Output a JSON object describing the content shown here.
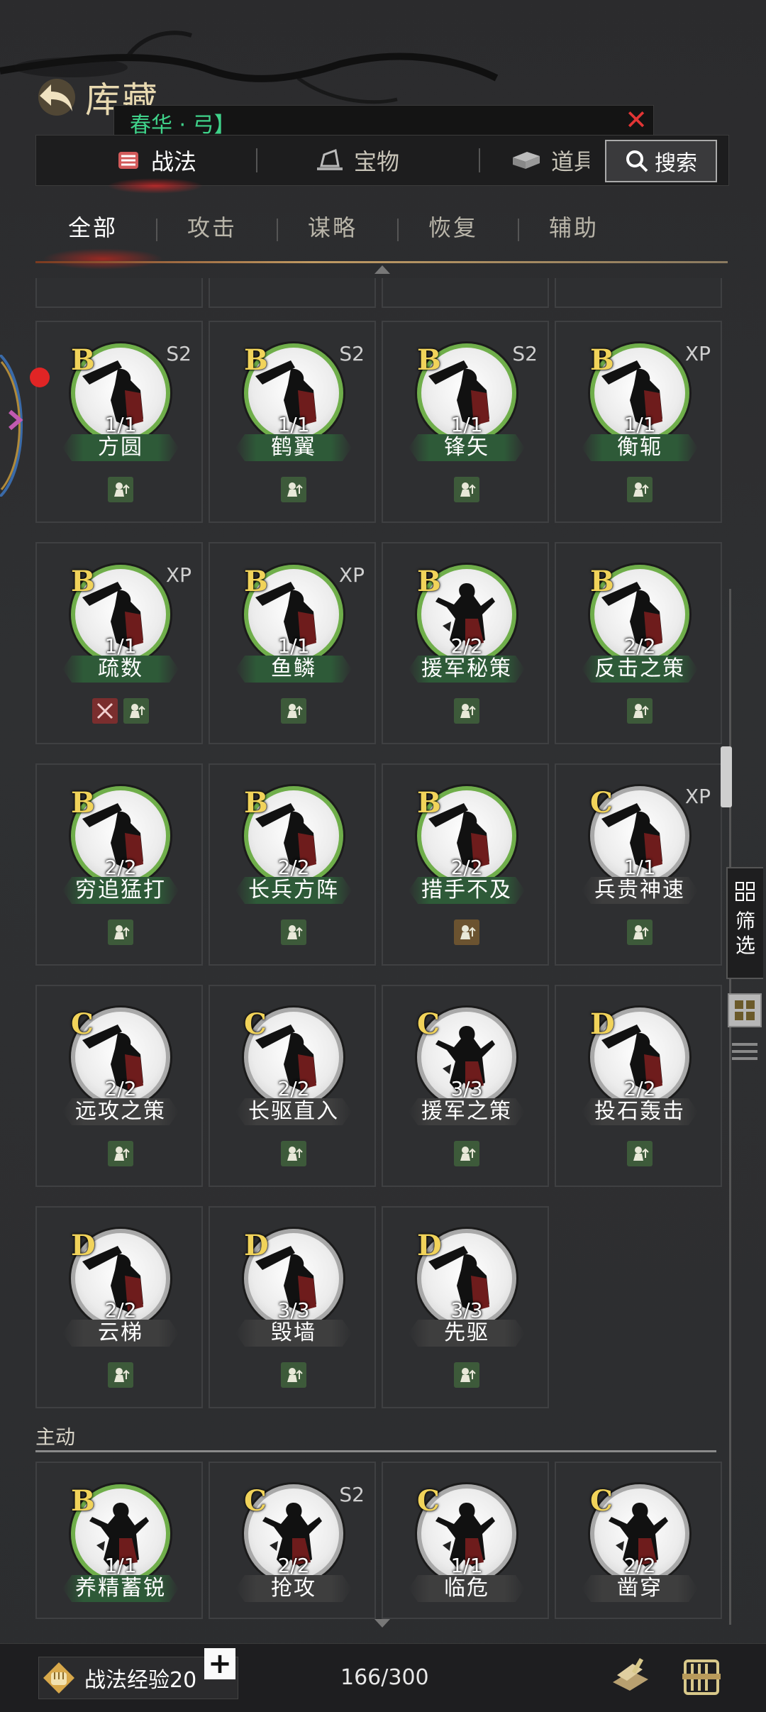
{
  "header": {
    "title": "库藏",
    "search_term": "春华 · 弓】"
  },
  "tabs": [
    {
      "label": "战法",
      "icon": "scroll-icon",
      "active": true
    },
    {
      "label": "宝物",
      "icon": "treasure-icon",
      "active": false
    },
    {
      "label": "道具",
      "icon": "item-box-icon",
      "active": false
    }
  ],
  "search_label": "搜索",
  "subtabs": [
    "全部",
    "攻击",
    "谋略",
    "恢复",
    "辅助"
  ],
  "tactics": [
    {
      "grade": "B",
      "season": "S2",
      "count": "1/1",
      "name": "方圆",
      "types": [
        "green"
      ]
    },
    {
      "grade": "B",
      "season": "S2",
      "count": "1/1",
      "name": "鹤翼",
      "types": [
        "green"
      ]
    },
    {
      "grade": "B",
      "season": "S2",
      "count": "1/1",
      "name": "锋矢",
      "types": [
        "green"
      ]
    },
    {
      "grade": "B",
      "season": "XP",
      "count": "1/1",
      "name": "衡轭",
      "types": [
        "green"
      ]
    },
    {
      "grade": "B",
      "season": "XP",
      "count": "1/1",
      "name": "疏数",
      "types": [
        "red",
        "green"
      ]
    },
    {
      "grade": "B",
      "season": "XP",
      "count": "1/1",
      "name": "鱼鳞",
      "types": [
        "green"
      ]
    },
    {
      "grade": "B",
      "season": "",
      "count": "2/2",
      "name": "援军秘策",
      "types": [
        "green"
      ]
    },
    {
      "grade": "B",
      "season": "",
      "count": "2/2",
      "name": "反击之策",
      "types": [
        "green"
      ]
    },
    {
      "grade": "B",
      "season": "",
      "count": "2/2",
      "name": "穷追猛打",
      "types": [
        "green"
      ]
    },
    {
      "grade": "B",
      "season": "",
      "count": "2/2",
      "name": "长兵方阵",
      "types": [
        "green"
      ]
    },
    {
      "grade": "B",
      "season": "",
      "count": "2/2",
      "name": "措手不及",
      "types": [
        "brown"
      ]
    },
    {
      "grade": "C",
      "season": "XP",
      "count": "1/1",
      "name": "兵贵神速",
      "types": [
        "green"
      ]
    },
    {
      "grade": "C",
      "season": "",
      "count": "2/2",
      "name": "远攻之策",
      "types": [
        "green"
      ]
    },
    {
      "grade": "C",
      "season": "",
      "count": "2/2",
      "name": "长驱直入",
      "types": [
        "green"
      ]
    },
    {
      "grade": "C",
      "season": "",
      "count": "3/3",
      "name": "援军之策",
      "types": [
        "green"
      ]
    },
    {
      "grade": "D",
      "season": "",
      "count": "2/2",
      "name": "投石轰击",
      "types": [
        "green"
      ]
    },
    {
      "grade": "D",
      "season": "",
      "count": "2/2",
      "name": "云梯",
      "types": [
        "green"
      ]
    },
    {
      "grade": "D",
      "season": "",
      "count": "3/3",
      "name": "毁墙",
      "types": [
        "green"
      ]
    },
    {
      "grade": "D",
      "season": "",
      "count": "3/3",
      "name": "先驱",
      "types": [
        "green"
      ]
    }
  ],
  "section_active": {
    "label": "主动",
    "tactics": [
      {
        "grade": "B",
        "season": "",
        "count": "1/1",
        "name": "养精蓄锐"
      },
      {
        "grade": "C",
        "season": "S2",
        "count": "2/2",
        "name": "抢攻"
      },
      {
        "grade": "C",
        "season": "",
        "count": "1/1",
        "name": "临危"
      },
      {
        "grade": "C",
        "season": "",
        "count": "2/2",
        "name": "凿穿"
      }
    ]
  },
  "side": {
    "filter_label": "筛选"
  },
  "footer": {
    "exp_label": "战法经验20",
    "plus": "+",
    "capacity": "166/300"
  },
  "colors": {
    "grade_gold": "#f1d35a",
    "search_green": "#3fd28a",
    "close_red": "#e23535",
    "border_green": "#6fae4a"
  }
}
